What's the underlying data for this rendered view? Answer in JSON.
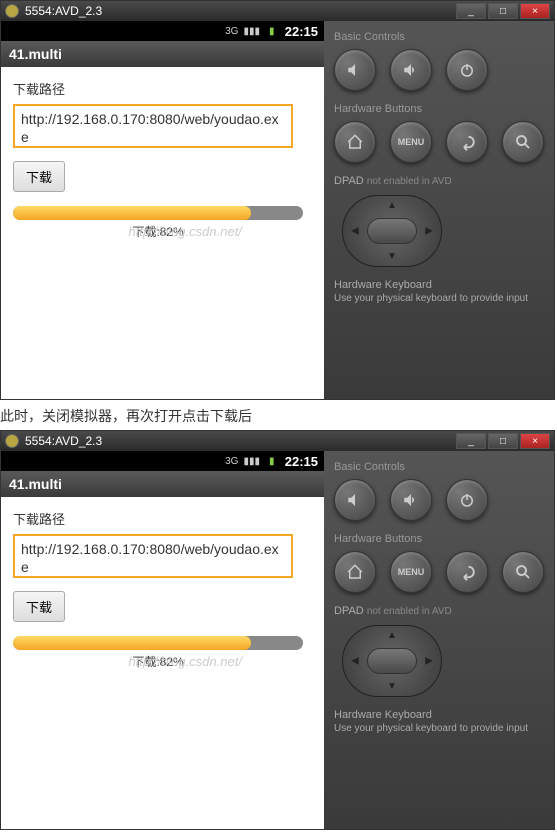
{
  "window": {
    "title": "5554:AVD_2.3",
    "min": "_",
    "max": "□",
    "close": "×"
  },
  "status": {
    "time": "22:15"
  },
  "app": {
    "title": "41.multi",
    "label": "下载路径",
    "url": "http://192.168.0.170:8080/web/youdao.exe",
    "download_btn": "下载",
    "progress_pct": 82,
    "progress_text": "下载:82%"
  },
  "watermark": "http://blog.csdn.net/",
  "panel": {
    "basic_label": "Basic Controls",
    "hw_label": "Hardware Buttons",
    "menu_label": "MENU",
    "dpad_label": "DPAD",
    "dpad_note": "not enabled in AVD",
    "kbd_label": "Hardware Keyboard",
    "kbd_note": "Use your physical keyboard to provide input"
  },
  "caption": "此时，关闭模拟器，再次打开点击下载后"
}
